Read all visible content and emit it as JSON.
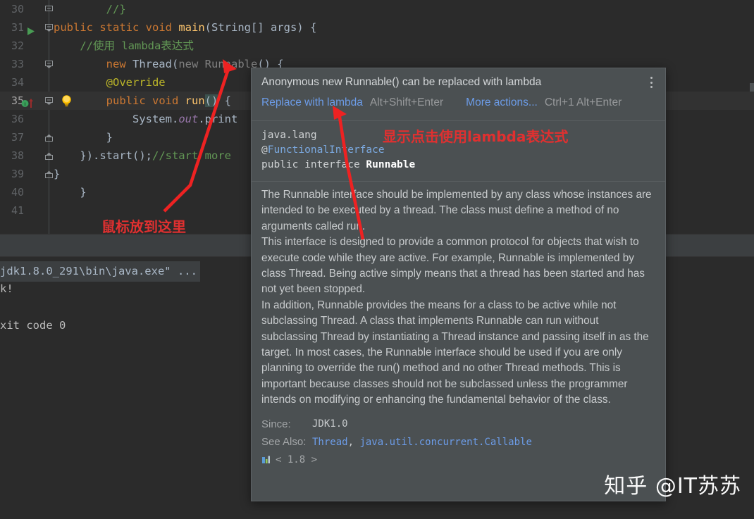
{
  "editor": {
    "lines": [
      {
        "num": "30",
        "fold": "end-top",
        "segments": [
          {
            "t": "        ",
            "c": "c-plain"
          },
          {
            "t": "//}",
            "c": "c-com"
          }
        ]
      },
      {
        "num": "31",
        "fold": "open",
        "run": true,
        "segments": [
          {
            "t": "public ",
            "c": "c-kw"
          },
          {
            "t": "static ",
            "c": "c-kw"
          },
          {
            "t": "void ",
            "c": "c-kw"
          },
          {
            "t": "main",
            "c": "c-ident"
          },
          {
            "t": "(String[] args) {",
            "c": "c-plain"
          }
        ]
      },
      {
        "num": "32",
        "segments": [
          {
            "t": "    ",
            "c": "c-plain"
          },
          {
            "t": "//使用 lambda表达式",
            "c": "c-com"
          }
        ]
      },
      {
        "num": "33",
        "fold": "open",
        "segments": [
          {
            "t": "        ",
            "c": "c-plain"
          },
          {
            "t": "new ",
            "c": "c-kw"
          },
          {
            "t": "Thread",
            "c": "c-plain"
          },
          {
            "t": "(",
            "c": "c-plain"
          },
          {
            "t": "new ",
            "c": "c-dim"
          },
          {
            "t": "Runnable",
            "c": "c-dim"
          },
          {
            "t": "() {",
            "c": "c-plain"
          }
        ]
      },
      {
        "num": "34",
        "segments": [
          {
            "t": "        ",
            "c": "c-plain"
          },
          {
            "t": "@Override",
            "c": "c-anno"
          }
        ]
      },
      {
        "num": "35",
        "fold": "open",
        "bulb": true,
        "breakpoint": true,
        "current": true,
        "segments": [
          {
            "t": "        ",
            "c": "c-plain"
          },
          {
            "t": "public ",
            "c": "c-kw"
          },
          {
            "t": "void ",
            "c": "c-kw"
          },
          {
            "t": "run",
            "c": "c-ident"
          },
          {
            "t": "()",
            "c": "c-brace-h"
          },
          {
            "t": " {",
            "c": "c-plain"
          }
        ]
      },
      {
        "num": "36",
        "segments": [
          {
            "t": "            ",
            "c": "c-plain"
          },
          {
            "t": "System.",
            "c": "c-plain"
          },
          {
            "t": "out",
            "c": "c-field"
          },
          {
            "t": ".print",
            "c": "c-plain"
          }
        ]
      },
      {
        "num": "37",
        "fold": "close",
        "segments": [
          {
            "t": "        }",
            "c": "c-plain"
          }
        ]
      },
      {
        "num": "38",
        "fold": "close",
        "segments": [
          {
            "t": "    }).start();",
            "c": "c-plain"
          },
          {
            "t": "//start more",
            "c": "c-linecom"
          }
        ]
      },
      {
        "num": "39",
        "fold": "close",
        "segments": [
          {
            "t": "}",
            "c": "c-plain"
          }
        ]
      },
      {
        "num": "40",
        "segments": [
          {
            "t": "    }",
            "c": "c-plain"
          }
        ]
      },
      {
        "num": "41",
        "segments": [
          {
            "t": "",
            "c": "c-plain"
          }
        ]
      }
    ]
  },
  "console": {
    "lines": [
      {
        "text": "jdk1.8.0_291\\bin\\java.exe\" ...",
        "style": "cmd"
      },
      {
        "text": "k!",
        "style": "plain"
      },
      {
        "text": "",
        "style": "plain"
      },
      {
        "text": "xit code 0",
        "style": "plain"
      }
    ]
  },
  "popup": {
    "title": "Anonymous new Runnable() can be replaced with lambda",
    "kebab_icon": "kebab-menu-icon",
    "actions": {
      "primary_label": "Replace with lambda",
      "primary_shortcut": "Alt+Shift+Enter",
      "secondary_label": "More actions...",
      "secondary_shortcut": "Ctrl+1 Alt+Enter"
    },
    "signature": {
      "package": "java.lang",
      "annotation_at": "@",
      "annotation_name": "FunctionalInterface",
      "declaration_keywords": "public interface ",
      "type_name": "Runnable"
    },
    "doc_paragraphs": [
      "The Runnable interface should be implemented by any class whose instances are intended to be executed by a thread. The class must define a method of no arguments called run.",
      "This interface is designed to provide a common protocol for objects that wish to execute code while they are active. For example, Runnable is implemented by class Thread. Being active simply means that a thread has been started and has not yet been stopped.",
      "In addition, Runnable provides the means for a class to be active while not subclassing Thread. A class that implements Runnable can run without subclassing Thread by instantiating a Thread instance and passing itself in as the target. In most cases, the Runnable interface should be used if you are only planning to override the run() method and no other Thread methods. This is important because classes should not be subclassed unless the programmer intends on modifying or enhancing the fundamental behavior of the class."
    ],
    "meta": {
      "since_label": "Since:",
      "since_value": "JDK1.0",
      "see_also_label": "See Also:",
      "see_also_links": [
        "Thread",
        "java.util.concurrent.Callable"
      ],
      "see_also_separator": ", ",
      "version_icon": "module-chart-icon",
      "version_text": "< 1.8 >"
    }
  },
  "annotations": {
    "left_note": "鼠标放到这里",
    "right_note": "显示点击使用lambda表达式",
    "color": "#e03030"
  },
  "watermark": {
    "text": "知乎 @IT苏苏"
  },
  "colors": {
    "editor_bg": "#2b2b2b",
    "popup_bg": "#4b5052",
    "toolband_bg": "#3c3f41",
    "link": "#6c9ce8",
    "keyword": "#cc7832",
    "comment": "#629755",
    "annotation_red": "#e03030"
  }
}
